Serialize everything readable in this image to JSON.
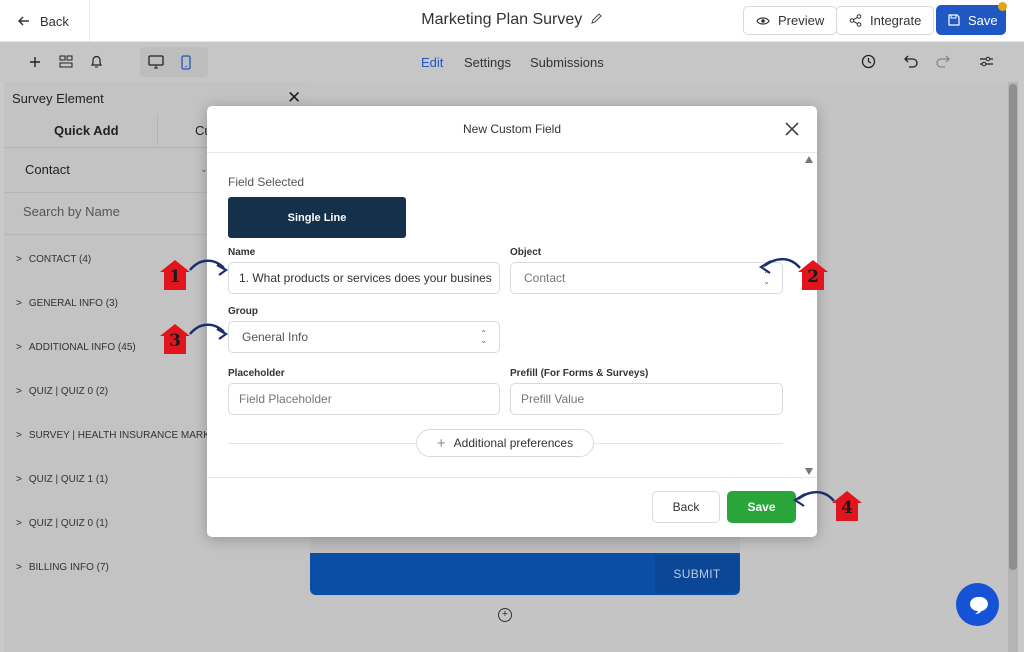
{
  "topbar": {
    "back_label": "Back",
    "title": "Marketing Plan Survey",
    "preview_label": "Preview",
    "integrate_label": "Integrate",
    "save_label": "Save"
  },
  "toolbar": {
    "tabs": [
      "Edit",
      "Settings",
      "Submissions"
    ],
    "active_tab": "Edit"
  },
  "left_panel": {
    "title": "Survey Element",
    "tabs": [
      "Quick Add",
      "Cu"
    ],
    "object_select": "Contact",
    "search_placeholder": "Search by Name",
    "categories": [
      "CONTACT (4)",
      "GENERAL INFO (3)",
      "ADDITIONAL INFO (45)",
      "QUIZ | QUIZ 0 (2)",
      "SURVEY | HEALTH INSURANCE MARKE",
      "QUIZ | QUIZ 1 (1)",
      "QUIZ | QUIZ 0 (1)",
      "BILLING INFO (7)"
    ]
  },
  "canvas": {
    "submit_label": "SUBMIT"
  },
  "modal": {
    "title": "New Custom Field",
    "field_selected_label": "Field Selected",
    "field_type": "Single Line",
    "name_label": "Name",
    "name_value": "1. What products or services does your busines",
    "object_label": "Object",
    "object_value": "Contact",
    "group_label": "Group",
    "group_value": "General Info",
    "placeholder_label": "Placeholder",
    "placeholder_placeholder": "Field Placeholder",
    "prefill_label": "Prefill (For Forms & Surveys)",
    "prefill_placeholder": "Prefill Value",
    "additional_pref_label": "Additional preferences",
    "back_label": "Back",
    "save_label": "Save"
  },
  "annotations": [
    "1",
    "2",
    "3",
    "4"
  ],
  "colors": {
    "primary": "#1f57c3",
    "save_green": "#2aa53a",
    "field_type_bg": "#15304a",
    "marker_red": "#e2141e",
    "arrow_navy": "#1c2e6b",
    "chat_blue": "#1552d6"
  }
}
